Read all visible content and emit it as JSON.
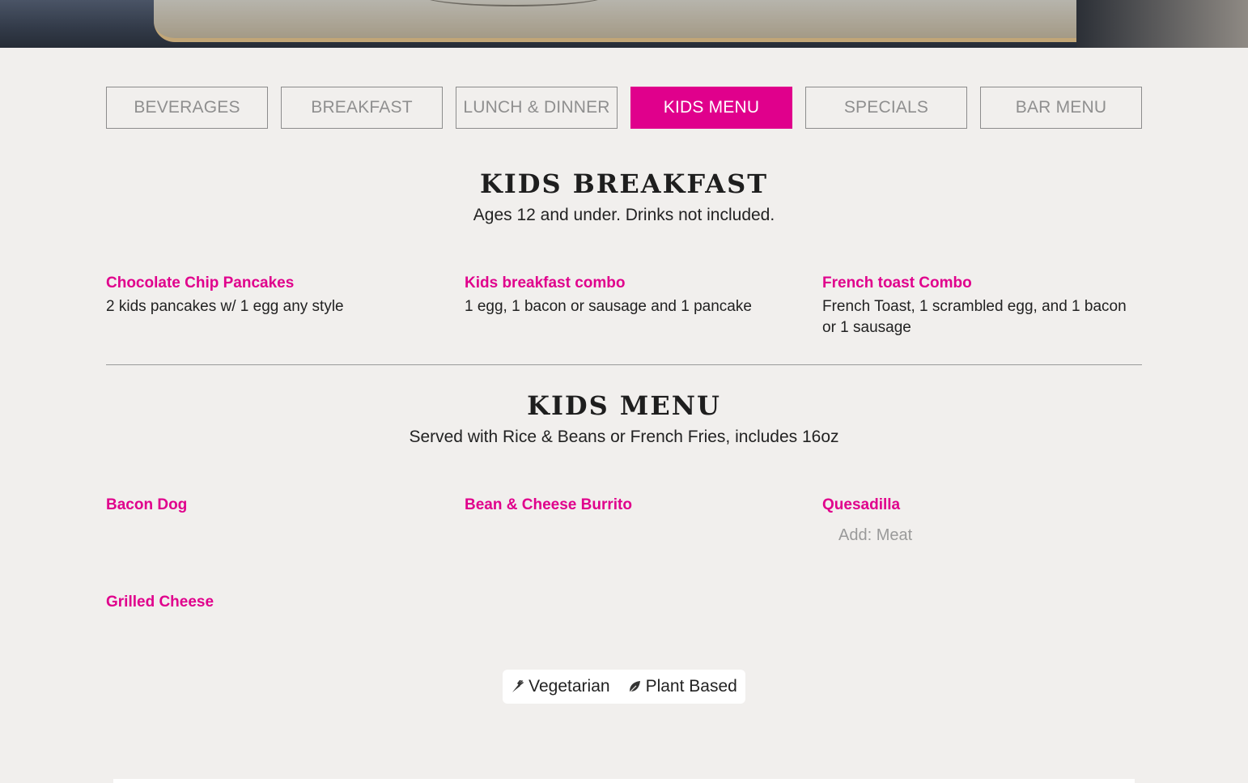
{
  "tabs": [
    {
      "label": "BEVERAGES",
      "active": false
    },
    {
      "label": "BREAKFAST",
      "active": false
    },
    {
      "label": "LUNCH & DINNER",
      "active": false
    },
    {
      "label": "KIDS MENU",
      "active": true
    },
    {
      "label": "SPECIALS",
      "active": false
    },
    {
      "label": "BAR MENU",
      "active": false
    }
  ],
  "sections": [
    {
      "title": "KIDS BREAKFAST",
      "subtitle": "Ages 12 and under. Drinks not included.",
      "items": [
        {
          "name": "Chocolate Chip Pancakes",
          "desc": "2 kids pancakes w/ 1 egg any style"
        },
        {
          "name": "Kids breakfast combo",
          "desc": "1 egg, 1 bacon or sausage and 1 pancake"
        },
        {
          "name": "French toast Combo",
          "desc": "French Toast, 1 scrambled egg, and 1 bacon or 1 sausage"
        }
      ]
    },
    {
      "title": "KIDS MENU",
      "subtitle": "Served with Rice & Beans or French Fries, includes 16oz",
      "items": [
        {
          "name": "Bacon Dog"
        },
        {
          "name": "Bean & Cheese Burrito"
        },
        {
          "name": "Quesadilla",
          "add": "Add: Meat"
        },
        {
          "name": "Grilled Cheese"
        }
      ]
    }
  ],
  "legend": [
    {
      "icon": "carrot-icon",
      "label": "Vegetarian"
    },
    {
      "icon": "leaf-icon",
      "label": "Plant Based"
    }
  ],
  "colors": {
    "accent": "#e0008c",
    "background": "#f1efed"
  }
}
